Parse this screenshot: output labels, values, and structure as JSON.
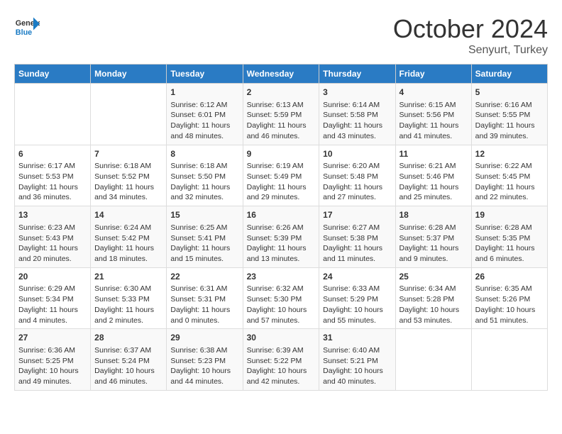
{
  "header": {
    "logo": {
      "line1": "General",
      "line2": "Blue"
    },
    "title": "October 2024",
    "subtitle": "Senyurt, Turkey"
  },
  "weekdays": [
    "Sunday",
    "Monday",
    "Tuesday",
    "Wednesday",
    "Thursday",
    "Friday",
    "Saturday"
  ],
  "weeks": [
    [
      {
        "day": "",
        "sunrise": "",
        "sunset": "",
        "daylight": ""
      },
      {
        "day": "",
        "sunrise": "",
        "sunset": "",
        "daylight": ""
      },
      {
        "day": "1",
        "sunrise": "Sunrise: 6:12 AM",
        "sunset": "Sunset: 6:01 PM",
        "daylight": "Daylight: 11 hours and 48 minutes."
      },
      {
        "day": "2",
        "sunrise": "Sunrise: 6:13 AM",
        "sunset": "Sunset: 5:59 PM",
        "daylight": "Daylight: 11 hours and 46 minutes."
      },
      {
        "day": "3",
        "sunrise": "Sunrise: 6:14 AM",
        "sunset": "Sunset: 5:58 PM",
        "daylight": "Daylight: 11 hours and 43 minutes."
      },
      {
        "day": "4",
        "sunrise": "Sunrise: 6:15 AM",
        "sunset": "Sunset: 5:56 PM",
        "daylight": "Daylight: 11 hours and 41 minutes."
      },
      {
        "day": "5",
        "sunrise": "Sunrise: 6:16 AM",
        "sunset": "Sunset: 5:55 PM",
        "daylight": "Daylight: 11 hours and 39 minutes."
      }
    ],
    [
      {
        "day": "6",
        "sunrise": "Sunrise: 6:17 AM",
        "sunset": "Sunset: 5:53 PM",
        "daylight": "Daylight: 11 hours and 36 minutes."
      },
      {
        "day": "7",
        "sunrise": "Sunrise: 6:18 AM",
        "sunset": "Sunset: 5:52 PM",
        "daylight": "Daylight: 11 hours and 34 minutes."
      },
      {
        "day": "8",
        "sunrise": "Sunrise: 6:18 AM",
        "sunset": "Sunset: 5:50 PM",
        "daylight": "Daylight: 11 hours and 32 minutes."
      },
      {
        "day": "9",
        "sunrise": "Sunrise: 6:19 AM",
        "sunset": "Sunset: 5:49 PM",
        "daylight": "Daylight: 11 hours and 29 minutes."
      },
      {
        "day": "10",
        "sunrise": "Sunrise: 6:20 AM",
        "sunset": "Sunset: 5:48 PM",
        "daylight": "Daylight: 11 hours and 27 minutes."
      },
      {
        "day": "11",
        "sunrise": "Sunrise: 6:21 AM",
        "sunset": "Sunset: 5:46 PM",
        "daylight": "Daylight: 11 hours and 25 minutes."
      },
      {
        "day": "12",
        "sunrise": "Sunrise: 6:22 AM",
        "sunset": "Sunset: 5:45 PM",
        "daylight": "Daylight: 11 hours and 22 minutes."
      }
    ],
    [
      {
        "day": "13",
        "sunrise": "Sunrise: 6:23 AM",
        "sunset": "Sunset: 5:43 PM",
        "daylight": "Daylight: 11 hours and 20 minutes."
      },
      {
        "day": "14",
        "sunrise": "Sunrise: 6:24 AM",
        "sunset": "Sunset: 5:42 PM",
        "daylight": "Daylight: 11 hours and 18 minutes."
      },
      {
        "day": "15",
        "sunrise": "Sunrise: 6:25 AM",
        "sunset": "Sunset: 5:41 PM",
        "daylight": "Daylight: 11 hours and 15 minutes."
      },
      {
        "day": "16",
        "sunrise": "Sunrise: 6:26 AM",
        "sunset": "Sunset: 5:39 PM",
        "daylight": "Daylight: 11 hours and 13 minutes."
      },
      {
        "day": "17",
        "sunrise": "Sunrise: 6:27 AM",
        "sunset": "Sunset: 5:38 PM",
        "daylight": "Daylight: 11 hours and 11 minutes."
      },
      {
        "day": "18",
        "sunrise": "Sunrise: 6:28 AM",
        "sunset": "Sunset: 5:37 PM",
        "daylight": "Daylight: 11 hours and 9 minutes."
      },
      {
        "day": "19",
        "sunrise": "Sunrise: 6:28 AM",
        "sunset": "Sunset: 5:35 PM",
        "daylight": "Daylight: 11 hours and 6 minutes."
      }
    ],
    [
      {
        "day": "20",
        "sunrise": "Sunrise: 6:29 AM",
        "sunset": "Sunset: 5:34 PM",
        "daylight": "Daylight: 11 hours and 4 minutes."
      },
      {
        "day": "21",
        "sunrise": "Sunrise: 6:30 AM",
        "sunset": "Sunset: 5:33 PM",
        "daylight": "Daylight: 11 hours and 2 minutes."
      },
      {
        "day": "22",
        "sunrise": "Sunrise: 6:31 AM",
        "sunset": "Sunset: 5:31 PM",
        "daylight": "Daylight: 11 hours and 0 minutes."
      },
      {
        "day": "23",
        "sunrise": "Sunrise: 6:32 AM",
        "sunset": "Sunset: 5:30 PM",
        "daylight": "Daylight: 10 hours and 57 minutes."
      },
      {
        "day": "24",
        "sunrise": "Sunrise: 6:33 AM",
        "sunset": "Sunset: 5:29 PM",
        "daylight": "Daylight: 10 hours and 55 minutes."
      },
      {
        "day": "25",
        "sunrise": "Sunrise: 6:34 AM",
        "sunset": "Sunset: 5:28 PM",
        "daylight": "Daylight: 10 hours and 53 minutes."
      },
      {
        "day": "26",
        "sunrise": "Sunrise: 6:35 AM",
        "sunset": "Sunset: 5:26 PM",
        "daylight": "Daylight: 10 hours and 51 minutes."
      }
    ],
    [
      {
        "day": "27",
        "sunrise": "Sunrise: 6:36 AM",
        "sunset": "Sunset: 5:25 PM",
        "daylight": "Daylight: 10 hours and 49 minutes."
      },
      {
        "day": "28",
        "sunrise": "Sunrise: 6:37 AM",
        "sunset": "Sunset: 5:24 PM",
        "daylight": "Daylight: 10 hours and 46 minutes."
      },
      {
        "day": "29",
        "sunrise": "Sunrise: 6:38 AM",
        "sunset": "Sunset: 5:23 PM",
        "daylight": "Daylight: 10 hours and 44 minutes."
      },
      {
        "day": "30",
        "sunrise": "Sunrise: 6:39 AM",
        "sunset": "Sunset: 5:22 PM",
        "daylight": "Daylight: 10 hours and 42 minutes."
      },
      {
        "day": "31",
        "sunrise": "Sunrise: 6:40 AM",
        "sunset": "Sunset: 5:21 PM",
        "daylight": "Daylight: 10 hours and 40 minutes."
      },
      {
        "day": "",
        "sunrise": "",
        "sunset": "",
        "daylight": ""
      },
      {
        "day": "",
        "sunrise": "",
        "sunset": "",
        "daylight": ""
      }
    ]
  ]
}
